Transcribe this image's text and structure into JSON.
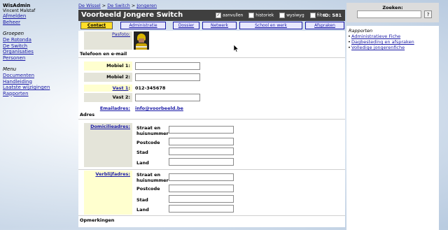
{
  "leftnav": {
    "app_title": "WisAdmin",
    "user": "Vincent Malstaf",
    "links": [
      "Afmelden",
      "Beheer"
    ],
    "groups_header": "Groepen",
    "groups": [
      "De Rotonda",
      "De Switch",
      "Organisaties",
      "Personen"
    ],
    "menu_header": "Menu",
    "menu": [
      "Documenten",
      "Handleiding",
      "Laatste wijzigingen",
      "Rapporten"
    ]
  },
  "breadcrumb": [
    "De Wissel",
    "De Switch",
    "Jongeren"
  ],
  "breadcrumb_sep": ">",
  "titlebar": {
    "title": "Voorbeeld Jongere Switch",
    "options": [
      {
        "label": "aanvullen",
        "checked": true
      },
      {
        "label": "historiek",
        "checked": false
      },
      {
        "label": "wysiwyg",
        "checked": false
      },
      {
        "label": "filter",
        "checked": false
      }
    ],
    "id_label": "ID: 581",
    "check_mark": "✓"
  },
  "tabs": [
    "Contact",
    "Administratie",
    "Dossier",
    "Netwerk",
    "School en werk",
    "Afspraken"
  ],
  "active_tab": "Contact",
  "form": {
    "pasfoto_label": "Pasfoto:",
    "section_contact": "Telefoon en e-mail",
    "mobiel1_label": "Mobiel 1:",
    "mobiel1_value": "",
    "mobiel2_label": "Mobiel 2:",
    "mobiel2_value": "",
    "vast1_label": "Vast 1",
    "vast1_value": "012-345678",
    "vast2_label": "Vast 2:",
    "vast2_value": "",
    "email_label": "Emailadres:",
    "email_value": "info@voorbeeld.be",
    "section_adres": "Adres",
    "domicilie_label": "Domicilieadres:",
    "verblijf_label": "Verblijfadres:",
    "address_fields": [
      "Straat en huisnummer",
      "Postcode",
      "Stad",
      "Land"
    ],
    "section_opm": "Opmerkingen"
  },
  "search": {
    "label": "Zoeken:",
    "value": "",
    "button": "?"
  },
  "reports": {
    "header": "Rapporten",
    "items": [
      "Administratieve Fiche",
      "Dagbesteding en afspraken",
      "Volledige jongerenfiche"
    ]
  }
}
